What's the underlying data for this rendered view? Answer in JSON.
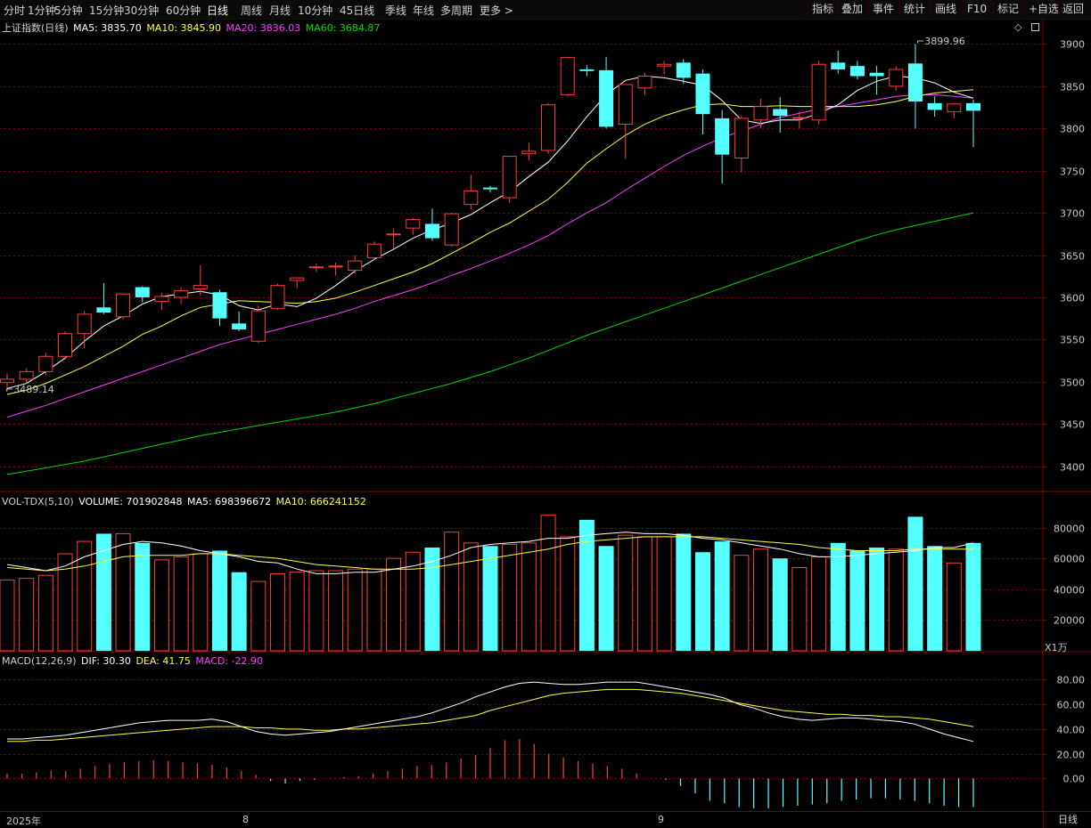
{
  "toolbar": {
    "tabs": [
      "分时",
      "1分钟",
      "5分钟",
      "15分钟",
      "30分钟",
      "60分钟",
      "日线",
      "周线",
      "月线",
      "10分钟",
      "45日线",
      "季线",
      "年线",
      "多周期",
      "更多 >"
    ],
    "active_tab": "日线",
    "right_buttons": [
      "指标",
      "叠加",
      "事件",
      "统计",
      "画线",
      "F10",
      "标记",
      "+自选",
      "返回"
    ]
  },
  "main_header": {
    "title": "上证指数(日线)",
    "ma5_label": "MA5: 3835.70",
    "ma10_label": "MA10: 3845.90",
    "ma20_label": "MA20: 3836.03",
    "ma60_label": "MA60: 3684.87",
    "icons": [
      "diamond-icon",
      "small-square-icon"
    ]
  },
  "vol_header": {
    "name": "VOL-TDX(5,10)",
    "volume_label": "VOLUME: 701902848",
    "ma5_label": "MA5: 698396672",
    "ma10_label": "MA10: 666241152",
    "unit": "X1万"
  },
  "macd_header": {
    "name": "MACD(12,26,9)",
    "dif_label": "DIF: 30.30",
    "dea_label": "DEA: 41.75",
    "macd_label": "MACD: -22.90"
  },
  "annotations": {
    "high": "3899.96",
    "low": "3489.14"
  },
  "bottom": {
    "year_label": "2025年",
    "month_labels": [
      "8",
      "9"
    ],
    "period_label": "日线"
  },
  "colors": {
    "up": "#ff3c3c",
    "down": "#54ffff",
    "ma5": "#ffffff",
    "ma10": "#ffff3c",
    "ma20": "#ff3cff",
    "ma60": "#00d800",
    "grid": "#800000",
    "axis_text": "#c8c8c8"
  },
  "chart_data": [
    {
      "type": "candlestick",
      "title": "上证指数(日线)",
      "ylim": [
        3370,
        3910
      ],
      "y_ticks": [
        3400,
        3450,
        3500,
        3550,
        3600,
        3650,
        3700,
        3750,
        3800,
        3850,
        3900
      ],
      "ohlc": [
        [
          3499,
          3510,
          3489,
          3503
        ],
        [
          3503,
          3516,
          3498,
          3512
        ],
        [
          3512,
          3534,
          3508,
          3530
        ],
        [
          3530,
          3560,
          3526,
          3557
        ],
        [
          3557,
          3584,
          3540,
          3580
        ],
        [
          3588,
          3617,
          3580,
          3582
        ],
        [
          3577,
          3605,
          3574,
          3604
        ],
        [
          3612,
          3613,
          3594,
          3600
        ],
        [
          3595,
          3605,
          3585,
          3601
        ],
        [
          3600,
          3612,
          3592,
          3608
        ],
        [
          3610,
          3638,
          3602,
          3614
        ],
        [
          3606,
          3609,
          3566,
          3575
        ],
        [
          3569,
          3583,
          3560,
          3562
        ],
        [
          3548,
          3590,
          3546,
          3584
        ],
        [
          3587,
          3616,
          3585,
          3614
        ],
        [
          3620,
          3624,
          3611,
          3623
        ],
        [
          3636,
          3640,
          3630,
          3636
        ],
        [
          3637,
          3641,
          3626,
          3637
        ],
        [
          3632,
          3650,
          3628,
          3643
        ],
        [
          3647,
          3666,
          3644,
          3663
        ],
        [
          3675,
          3682,
          3658,
          3675
        ],
        [
          3682,
          3694,
          3674,
          3692
        ],
        [
          3687,
          3705,
          3667,
          3670
        ],
        [
          3662,
          3700,
          3660,
          3699
        ],
        [
          3710,
          3745,
          3704,
          3726
        ],
        [
          3730,
          3732,
          3724,
          3728
        ],
        [
          3718,
          3767,
          3712,
          3767
        ],
        [
          3770,
          3783,
          3762,
          3773
        ],
        [
          3774,
          3830,
          3770,
          3828
        ],
        [
          3840,
          3884,
          3838,
          3884
        ],
        [
          3870,
          3875,
          3862,
          3868
        ],
        [
          3869,
          3885,
          3800,
          3802
        ],
        [
          3805,
          3852,
          3764,
          3852
        ],
        [
          3848,
          3866,
          3840,
          3862
        ],
        [
          3874,
          3880,
          3864,
          3876
        ],
        [
          3878,
          3882,
          3853,
          3860
        ],
        [
          3865,
          3870,
          3793,
          3817
        ],
        [
          3812,
          3822,
          3735,
          3769
        ],
        [
          3765,
          3815,
          3748,
          3812
        ],
        [
          3810,
          3835,
          3800,
          3826
        ],
        [
          3823,
          3837,
          3795,
          3815
        ],
        [
          3813,
          3820,
          3800,
          3813
        ],
        [
          3810,
          3880,
          3805,
          3876
        ],
        [
          3878,
          3892,
          3865,
          3870
        ],
        [
          3874,
          3880,
          3858,
          3862
        ],
        [
          3866,
          3874,
          3840,
          3862
        ],
        [
          3850,
          3874,
          3845,
          3870
        ],
        [
          3877,
          3900,
          3800,
          3832
        ],
        [
          3830,
          3838,
          3814,
          3822
        ],
        [
          3820,
          3830,
          3812,
          3829
        ],
        [
          3830,
          3834,
          3778,
          3821
        ]
      ],
      "ma5": [
        3492,
        3498,
        3512,
        3528,
        3548,
        3566,
        3578,
        3592,
        3601,
        3604,
        3607,
        3603,
        3590,
        3585,
        3592,
        3589,
        3599,
        3614,
        3631,
        3645,
        3657,
        3670,
        3680,
        3688,
        3698,
        3712,
        3725,
        3743,
        3760,
        3785,
        3814,
        3840,
        3857,
        3862,
        3860,
        3856,
        3851,
        3833,
        3810,
        3806,
        3810,
        3810,
        3818,
        3828,
        3845,
        3856,
        3862,
        3860,
        3854,
        3843,
        3836
      ],
      "ma10": [
        3485,
        3490,
        3498,
        3508,
        3518,
        3530,
        3542,
        3556,
        3566,
        3578,
        3588,
        3592,
        3596,
        3595,
        3594,
        3593,
        3595,
        3599,
        3606,
        3614,
        3622,
        3630,
        3640,
        3652,
        3664,
        3677,
        3688,
        3702,
        3716,
        3736,
        3759,
        3776,
        3792,
        3805,
        3815,
        3822,
        3828,
        3829,
        3826,
        3826,
        3827,
        3826,
        3826,
        3826,
        3826,
        3828,
        3832,
        3838,
        3842,
        3844,
        3846
      ],
      "ma20": [
        3458,
        3465,
        3472,
        3480,
        3488,
        3496,
        3504,
        3512,
        3520,
        3528,
        3536,
        3544,
        3550,
        3556,
        3562,
        3568,
        3574,
        3580,
        3587,
        3595,
        3602,
        3609,
        3617,
        3626,
        3634,
        3643,
        3652,
        3662,
        3673,
        3687,
        3700,
        3712,
        3727,
        3741,
        3755,
        3768,
        3779,
        3789,
        3797,
        3805,
        3813,
        3818,
        3823,
        3826,
        3830,
        3834,
        3838,
        3840,
        3840,
        3838,
        3836
      ],
      "ma60": [
        3390,
        3394,
        3398,
        3402,
        3406,
        3411,
        3416,
        3421,
        3426,
        3431,
        3436,
        3440,
        3444,
        3448,
        3452,
        3456,
        3460,
        3464,
        3469,
        3474,
        3480,
        3486,
        3492,
        3498,
        3505,
        3512,
        3520,
        3528,
        3537,
        3546,
        3555,
        3563,
        3571,
        3579,
        3587,
        3595,
        3603,
        3611,
        3619,
        3627,
        3635,
        3643,
        3651,
        3659,
        3667,
        3674,
        3680,
        3685,
        3690,
        3695,
        3700
      ]
    },
    {
      "type": "bar",
      "title": "VOL-TDX(5,10)",
      "unit": "X1万",
      "ylim": [
        0,
        93000
      ],
      "y_ticks": [
        20000,
        40000,
        60000,
        80000
      ],
      "values": [
        46000,
        47000,
        49000,
        63000,
        71000,
        76000,
        76000,
        70000,
        59000,
        61000,
        63000,
        65000,
        51000,
        45000,
        50000,
        51000,
        52000,
        52000,
        53000,
        53000,
        60000,
        64000,
        67000,
        77000,
        70000,
        68000,
        69000,
        70000,
        88000,
        74000,
        85000,
        68000,
        75000,
        74000,
        74000,
        76000,
        64000,
        71000,
        62000,
        66000,
        60000,
        54000,
        61000,
        70000,
        65000,
        67000,
        66000,
        87000,
        68000,
        57000,
        70000
      ],
      "ma5": [
        56000,
        54000,
        52000,
        55000,
        61000,
        65000,
        69000,
        71000,
        70000,
        68000,
        65000,
        63000,
        61000,
        58000,
        57000,
        53000,
        50000,
        50000,
        51000,
        51000,
        53000,
        55000,
        58000,
        62000,
        67000,
        69000,
        70000,
        71000,
        73000,
        73000,
        75000,
        76000,
        77000,
        76000,
        76000,
        75000,
        73000,
        72000,
        70000,
        68000,
        66000,
        63000,
        61000,
        61000,
        62000,
        63000,
        64000,
        65000,
        67000,
        67000,
        70000
      ],
      "ma10": [
        54000,
        53000,
        52000,
        53000,
        55000,
        58000,
        61000,
        62000,
        62000,
        62000,
        63000,
        63000,
        62000,
        61000,
        60000,
        58000,
        56000,
        55000,
        54000,
        53000,
        53000,
        53000,
        54000,
        56000,
        58000,
        60000,
        62000,
        64000,
        66000,
        69000,
        71000,
        72000,
        73000,
        74000,
        74000,
        74000,
        74000,
        73000,
        72000,
        71000,
        70000,
        69000,
        67000,
        66000,
        65000,
        65000,
        65000,
        66000,
        66000,
        66000,
        66000
      ]
    },
    {
      "type": "bar",
      "title": "MACD(12,26,9)",
      "ylim": [
        -22,
        91
      ],
      "y_ticks": [
        0,
        20,
        40,
        60,
        80
      ],
      "dif": [
        32,
        32,
        33,
        34,
        35,
        37,
        39,
        41,
        43,
        45,
        46,
        47,
        47,
        47,
        48,
        46,
        42,
        38,
        36,
        35,
        36,
        37,
        38,
        40,
        42,
        44,
        46,
        48,
        50,
        53,
        57,
        61,
        66,
        70,
        74,
        77,
        78,
        77,
        76,
        76,
        77,
        78,
        78,
        78,
        76,
        74,
        72,
        70,
        68,
        65,
        60,
        57,
        53,
        50,
        48,
        47,
        48,
        49,
        49,
        48,
        47,
        46,
        44,
        40,
        36,
        33,
        30
      ],
      "dea": [
        30,
        30,
        31,
        31,
        32,
        33,
        34,
        35,
        36,
        37,
        38,
        39,
        40,
        41,
        42,
        42,
        42,
        41,
        41,
        40,
        40,
        39,
        39,
        40,
        40,
        41,
        42,
        43,
        44,
        45,
        47,
        49,
        51,
        55,
        58,
        61,
        64,
        67,
        69,
        70,
        71,
        72,
        72,
        72,
        71,
        70,
        69,
        67,
        65,
        63,
        61,
        59,
        57,
        55,
        54,
        53,
        52,
        52,
        51,
        51,
        50,
        50,
        49,
        48,
        46,
        44,
        42
      ],
      "macd": [
        4,
        4,
        5,
        6,
        6,
        8,
        10,
        12,
        13,
        14,
        15,
        14,
        13,
        12,
        11,
        9,
        6,
        3,
        -2,
        -4,
        -2,
        -1,
        0,
        1,
        2,
        4,
        6,
        8,
        10,
        11,
        13,
        16,
        19,
        25,
        31,
        32,
        28,
        20,
        17,
        14,
        12,
        10,
        8,
        4,
        0,
        -1,
        -6,
        -12,
        -18,
        -20,
        -23,
        -24,
        -24,
        -23,
        -22,
        -21,
        -20,
        -18,
        -17,
        -16,
        -16,
        -17,
        -18,
        -20,
        -22,
        -23,
        -23
      ]
    }
  ]
}
